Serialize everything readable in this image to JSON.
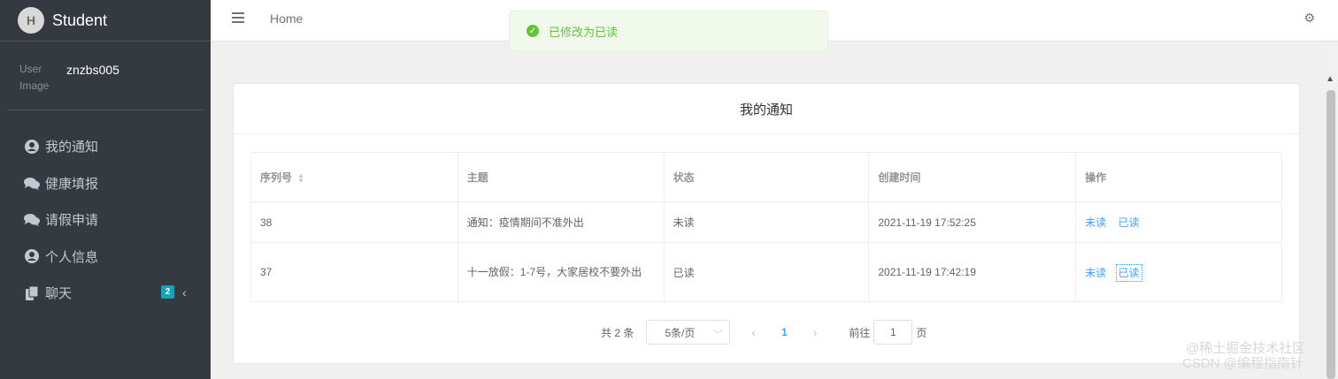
{
  "brand": {
    "logo_text": "H",
    "title": "Student"
  },
  "user": {
    "image_alt": "User Image",
    "name": "znzbs005"
  },
  "sidebar": {
    "items": [
      {
        "label": "我的通知",
        "icon": "user-circle-icon"
      },
      {
        "label": "健康填报",
        "icon": "comments-icon"
      },
      {
        "label": "请假申请",
        "icon": "comments-icon"
      },
      {
        "label": "个人信息",
        "icon": "user-circle-icon"
      },
      {
        "label": "聊天",
        "icon": "copy-icon",
        "badge": "2",
        "chevron": "‹"
      }
    ]
  },
  "topbar": {
    "home": "Home",
    "gear": "⚙"
  },
  "toast": {
    "message": "已修改为已读",
    "check": "✓"
  },
  "card": {
    "title": "我的通知"
  },
  "table": {
    "headers": [
      "序列号",
      "主题",
      "状态",
      "创建时间",
      "操作"
    ],
    "rows": [
      {
        "id": "38",
        "topic": "通知：疫情期间不准外出",
        "status": "未读",
        "created": "2021-11-19 17:52:25",
        "op_unread": "未读",
        "op_read": "已读"
      },
      {
        "id": "37",
        "topic": "十一放假：1-7号，大家居校不要外出",
        "status": "已读",
        "created": "2021-11-19 17:42:19",
        "op_unread": "未读",
        "op_read": "已读"
      }
    ]
  },
  "pagination": {
    "total": "共 2 条",
    "page_size": "5条/页",
    "current_page": "1",
    "goto_label": "前往",
    "goto_value": "1",
    "page_suffix": "页"
  },
  "watermark": {
    "line1": "@稀土掘金技术社区",
    "line2": "CSDN @编程指南针"
  },
  "colors": {
    "sidebar": "#343a40",
    "accent": "#409eff",
    "success": "#67c23a",
    "badge": "#17a2b8"
  }
}
